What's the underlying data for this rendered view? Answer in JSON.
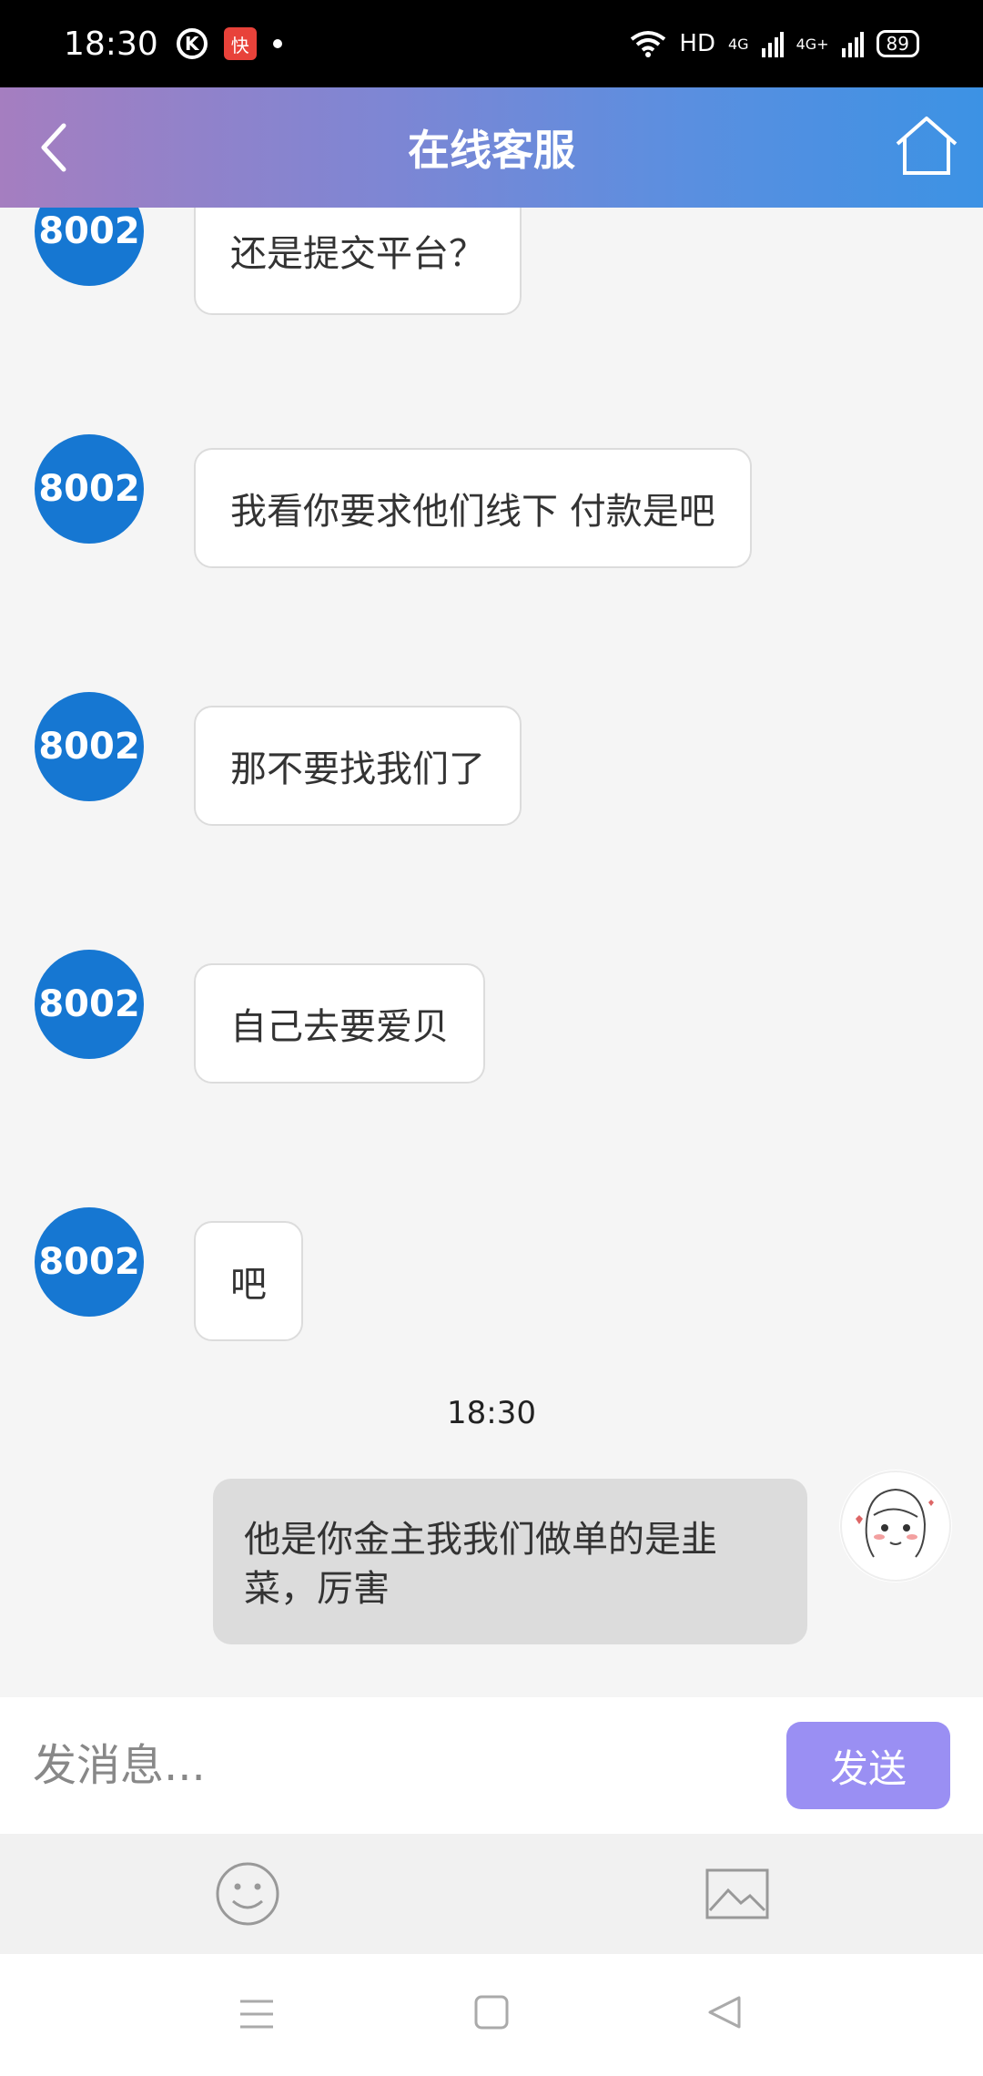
{
  "status_bar": {
    "time": "18:30",
    "app_icon_1": "K",
    "app_icon_2": "快",
    "network": "HD",
    "signal_1": "4G",
    "signal_2": "4G+",
    "battery": "89"
  },
  "header": {
    "title": "在线客服",
    "back_icon": "chevron-left-icon",
    "home_icon": "home-icon"
  },
  "messages": [
    {
      "sender": "8002",
      "text": "还是提交平台？"
    },
    {
      "sender": "8002",
      "text": "我看你要求他们线下 付款是吧"
    },
    {
      "sender": "8002",
      "text": "那不要找我们了"
    },
    {
      "sender": "8002",
      "text": "自己去要爱贝"
    },
    {
      "sender": "8002",
      "text": "吧"
    }
  ],
  "timestamp": "18:30",
  "my_message": {
    "line1": "他是你金主我我们做单的是韭",
    "line2": "菜，厉害"
  },
  "input": {
    "placeholder": "发消息...",
    "send_label": "发送"
  },
  "toolbar": {
    "emoji_icon": "smiley-icon",
    "image_icon": "image-icon"
  },
  "colors": {
    "avatar_blue": "#1677d2",
    "send_button": "#9a8ff3",
    "my_bubble": "#dcdcdc"
  }
}
